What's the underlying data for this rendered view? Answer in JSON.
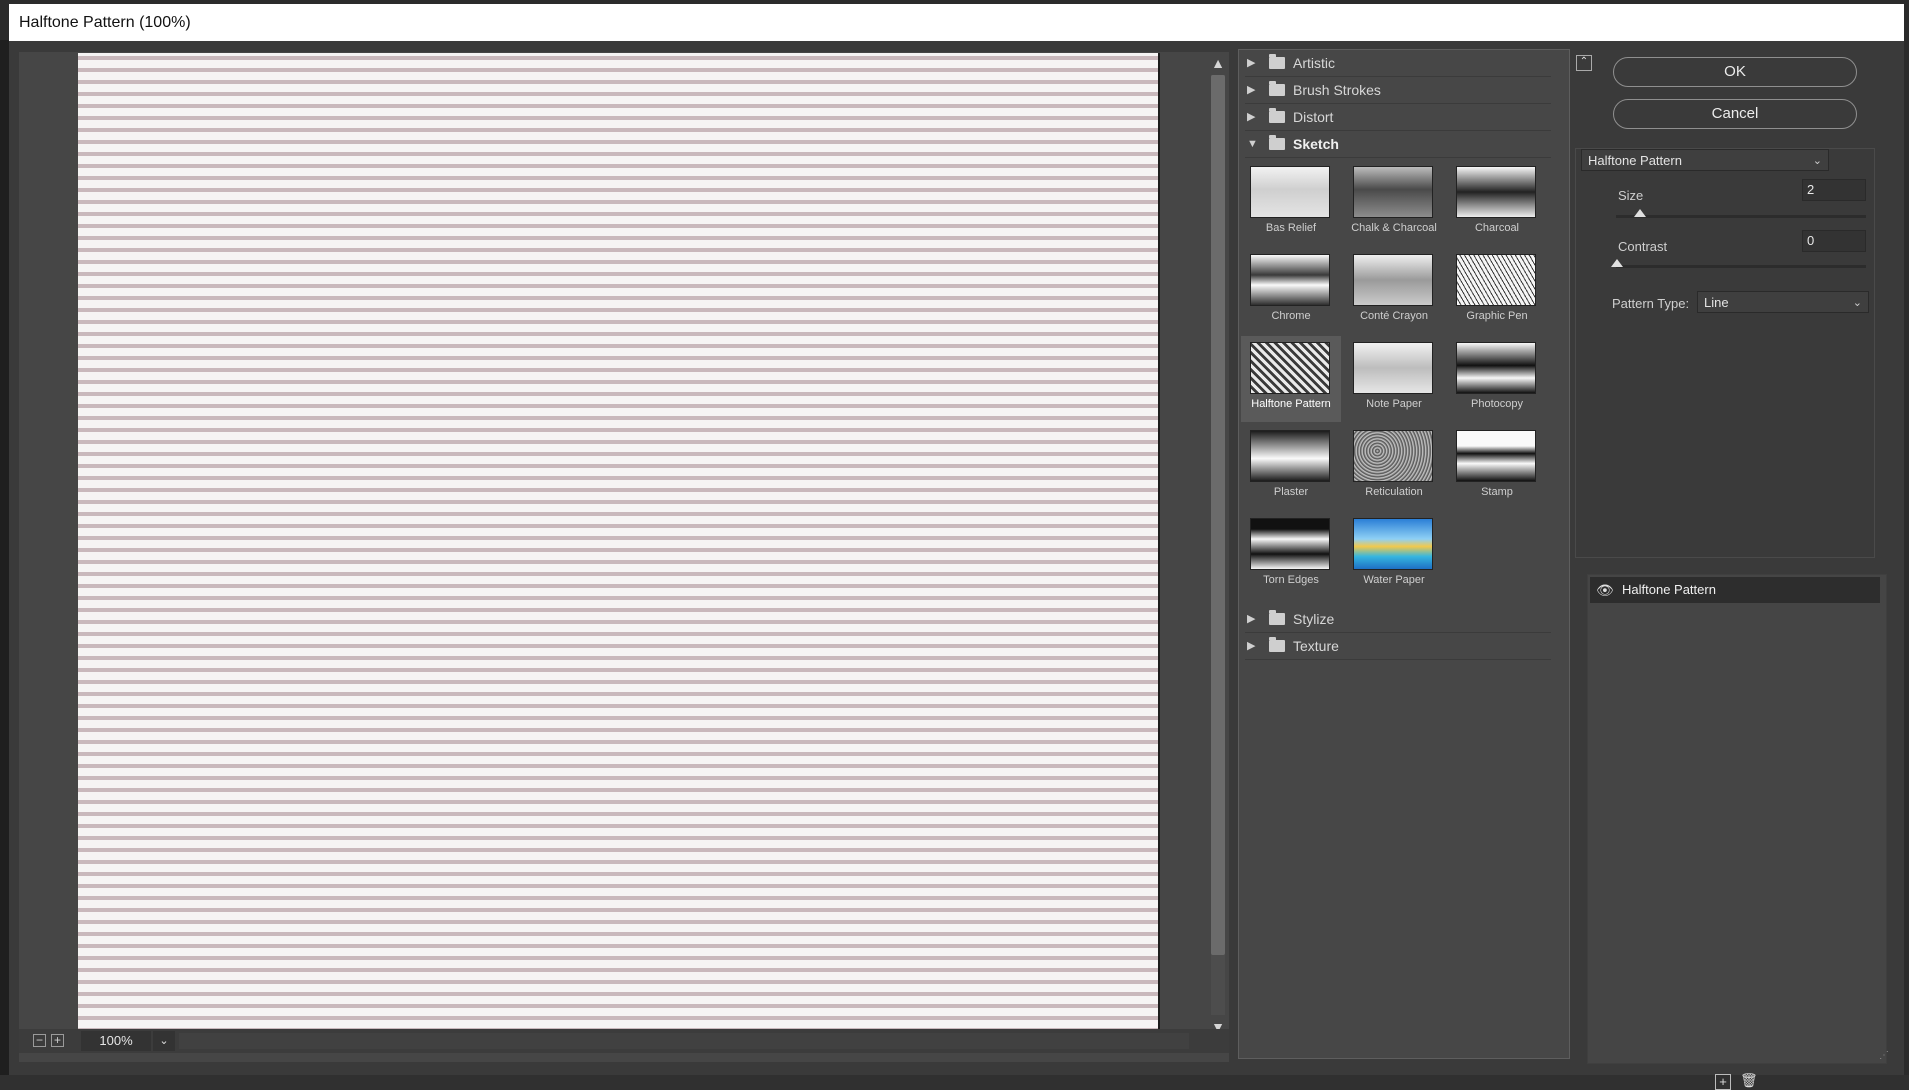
{
  "window": {
    "title": "Halftone Pattern (100%)"
  },
  "preview": {
    "zoom": "100%",
    "zoom_out_glyph": "−",
    "zoom_in_glyph": "+",
    "dropdown_glyph": "⌄"
  },
  "gallery": {
    "categories": [
      {
        "label": "Artistic",
        "expanded": false
      },
      {
        "label": "Brush Strokes",
        "expanded": false
      },
      {
        "label": "Distort",
        "expanded": false
      },
      {
        "label": "Sketch",
        "expanded": true
      },
      {
        "label": "Stylize",
        "expanded": false
      },
      {
        "label": "Texture",
        "expanded": false
      }
    ],
    "sketch_filters": [
      {
        "label": "Bas Relief",
        "selected": false
      },
      {
        "label": "Chalk & Charcoal",
        "selected": false
      },
      {
        "label": "Charcoal",
        "selected": false
      },
      {
        "label": "Chrome",
        "selected": false
      },
      {
        "label": "Conté Crayon",
        "selected": false
      },
      {
        "label": "Graphic Pen",
        "selected": false
      },
      {
        "label": "Halftone Pattern",
        "selected": true
      },
      {
        "label": "Note Paper",
        "selected": false
      },
      {
        "label": "Photocopy",
        "selected": false
      },
      {
        "label": "Plaster",
        "selected": false
      },
      {
        "label": "Reticulation",
        "selected": false
      },
      {
        "label": "Stamp",
        "selected": false
      },
      {
        "label": "Torn Edges",
        "selected": false
      },
      {
        "label": "Water Paper",
        "selected": false
      }
    ]
  },
  "buttons": {
    "ok": "OK",
    "cancel": "Cancel"
  },
  "settings": {
    "filter_select": "Halftone Pattern",
    "size_label": "Size",
    "size_value": "2",
    "contrast_label": "Contrast",
    "contrast_value": "0",
    "pattern_type_label": "Pattern Type:",
    "pattern_type_value": "Line"
  },
  "layers": {
    "items": [
      {
        "label": "Halftone Pattern",
        "visible": true
      }
    ],
    "new_layer_glyph": "+",
    "delete_glyph": "🗑"
  },
  "colors": {
    "accent_selected": "#5a5a5a",
    "panel": "#474747",
    "background": "#3a3a3a"
  }
}
